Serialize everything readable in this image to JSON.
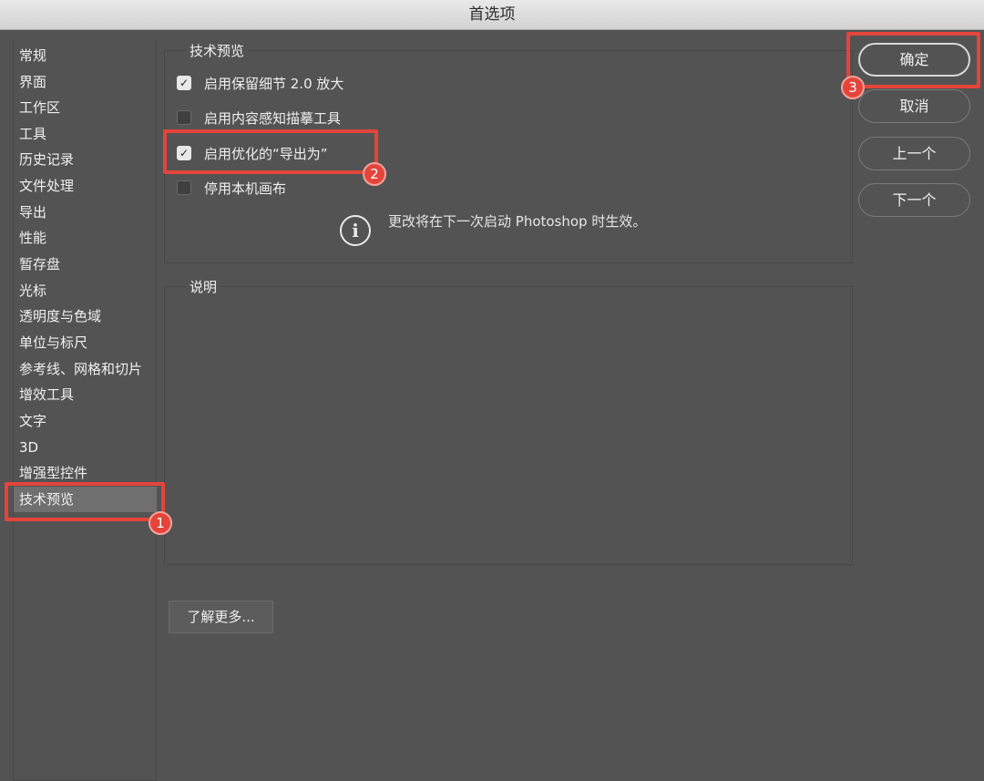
{
  "window": {
    "title": "首选项"
  },
  "sidebar": {
    "items": [
      {
        "label": "常规"
      },
      {
        "label": "界面"
      },
      {
        "label": "工作区"
      },
      {
        "label": "工具"
      },
      {
        "label": "历史记录"
      },
      {
        "label": "文件处理"
      },
      {
        "label": "导出"
      },
      {
        "label": "性能"
      },
      {
        "label": "暂存盘"
      },
      {
        "label": "光标"
      },
      {
        "label": "透明度与色域"
      },
      {
        "label": "单位与标尺"
      },
      {
        "label": "参考线、网格和切片"
      },
      {
        "label": "增效工具"
      },
      {
        "label": "文字"
      },
      {
        "label": "3D"
      },
      {
        "label": "增强型控件"
      },
      {
        "label": "技术预览",
        "selected": true
      }
    ]
  },
  "tech_preview": {
    "title": "技术预览",
    "options": [
      {
        "label": "启用保留细节 2.0 放大",
        "checked": true
      },
      {
        "label": "启用内容感知描摹工具",
        "checked": false
      },
      {
        "label": "启用优化的“导出为”",
        "checked": true
      },
      {
        "label": "停用本机画布",
        "checked": false
      }
    ],
    "info_icon": "info-icon",
    "info_text": "更改将在下一次启动 Photoshop 时生效。"
  },
  "description": {
    "title": "说明"
  },
  "learn_more_label": "了解更多...",
  "buttons": {
    "ok": "确定",
    "cancel": "取消",
    "prev": "上一个",
    "next": "下一个"
  },
  "annotations": {
    "badge_1": "1",
    "badge_2": "2",
    "badge_3": "3",
    "color": "#e4443a"
  }
}
